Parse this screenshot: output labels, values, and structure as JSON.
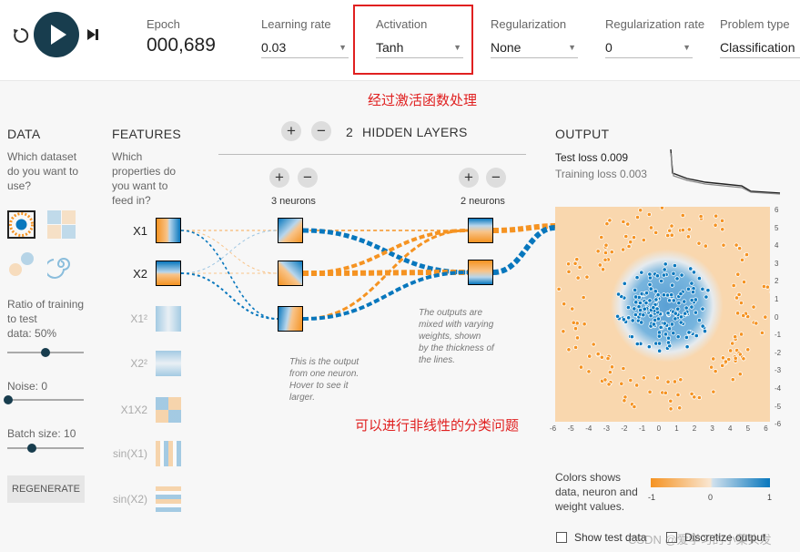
{
  "controls": {
    "reset_icon": "reset-icon",
    "play_icon": "play-icon",
    "step_icon": "step-icon"
  },
  "epoch": {
    "label": "Epoch",
    "value": "000,689"
  },
  "learning_rate": {
    "label": "Learning rate",
    "value": "0.03"
  },
  "activation": {
    "label": "Activation",
    "value": "Tanh"
  },
  "regularization": {
    "label": "Regularization",
    "value": "None"
  },
  "regularization_rate": {
    "label": "Regularization rate",
    "value": "0"
  },
  "problem_type": {
    "label": "Problem type",
    "value": "Classification"
  },
  "annotations": {
    "activation_note": "经过激活函数处理",
    "nonlinear_note": "可以进行非线性的分类问题"
  },
  "data_panel": {
    "title": "DATA",
    "question": [
      "Which dataset",
      "do you want to",
      "use?"
    ],
    "ratio_label": [
      "Ratio of training",
      "to test",
      "data:  50%"
    ],
    "ratio_value": 50,
    "noise_label": "Noise:  0",
    "noise_value": 0,
    "batch_label": "Batch size:  10",
    "batch_value": 10,
    "regenerate": "REGENERATE"
  },
  "features_panel": {
    "title": "FEATURES",
    "question": [
      "Which",
      "properties do",
      "you want to",
      "feed in?"
    ],
    "features": [
      {
        "label": "X1",
        "active": true
      },
      {
        "label": "X2",
        "active": true
      },
      {
        "label": "X1²",
        "active": false
      },
      {
        "label": "X2²",
        "active": false
      },
      {
        "label": "X1X2",
        "active": false
      },
      {
        "label": "sin(X1)",
        "active": false
      },
      {
        "label": "sin(X2)",
        "active": false
      }
    ]
  },
  "network": {
    "hidden_layers_count": "2",
    "hidden_layers_label": "HIDDEN LAYERS",
    "layer1_label": "3 neurons",
    "layer2_label": "2 neurons",
    "note_neuron": [
      "This is the output",
      "from one neuron.",
      "Hover to see it",
      "larger."
    ],
    "note_outputs": [
      "The outputs are",
      "mixed with varying",
      "weights, shown",
      "by the thickness of",
      "the lines."
    ]
  },
  "output_panel": {
    "title": "OUTPUT",
    "test_loss_label": "Test loss",
    "test_loss_value": "0.009",
    "training_loss_label": "Training loss",
    "training_loss_value": "0.003",
    "y_ticks": [
      "6",
      "5",
      "4",
      "3",
      "2",
      "1",
      "0",
      "-1",
      "-2",
      "-3",
      "-4",
      "-5",
      "-6"
    ],
    "x_ticks": [
      "-6",
      "-5",
      "-4",
      "-3",
      "-2",
      "-1",
      "0",
      "1",
      "2",
      "3",
      "4",
      "5",
      "6"
    ],
    "legend_text": [
      "Colors shows",
      "data, neuron and",
      "weight values."
    ],
    "legend_ticks": [
      "-1",
      "0",
      "1"
    ],
    "show_test_label": "Show test data",
    "discretize_label": "Discretize output",
    "watermark": "CSDN @爱学习的小菜头发"
  },
  "colors": {
    "orange": "#f59322",
    "blue": "#0877bd",
    "dark": "#183d4e",
    "red": "#e02020"
  }
}
